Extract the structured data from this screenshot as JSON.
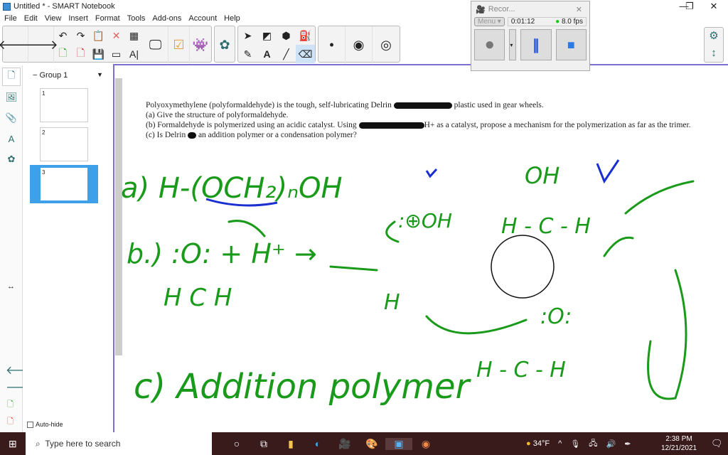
{
  "window": {
    "title": "Untitled * - SMART Notebook"
  },
  "menu": [
    "File",
    "Edit",
    "View",
    "Insert",
    "Format",
    "Tools",
    "Add-ons",
    "Account",
    "Help"
  ],
  "sorter": {
    "group_label": "Group 1",
    "pages": [
      "1",
      "2",
      "3"
    ],
    "auto_hide": "Auto-hide"
  },
  "recorder": {
    "title": "Recor...",
    "menu_label": "Menu",
    "time": "0:01:12",
    "fps": "8.0 fps"
  },
  "question": {
    "line1a": "Polyoxymethylene (polyformaldehyde) is the tough, self-lubricating Delrin",
    "line1b": "plastic used in gear wheels.",
    "line2": "(a) Give the structure of polyformaldehyde.",
    "line3a": "(b) Formaldehyde is polymerized using an acidic catalyst. Using",
    "line3b": "H+ as a catalyst, propose a mechanism for the polymerization as far as the trimer.",
    "line4a": "(c) Is Delrin",
    "line4b": "an addition polymer or a condensation polymer?"
  },
  "handwriting": {
    "a": "a) H-(OCH₂)ₙOH",
    "b": "b.)  :O:  + H⁺ →",
    "b2": "H   C   H",
    "c": "c) Addition polymer",
    "oh": "OH",
    "hch": "H - C - H",
    "plus": ":⊕OH",
    "h": "H",
    "o2": ":O:",
    "hch2": "H - C - H"
  },
  "taskbar": {
    "search_placeholder": "Type here to search",
    "weather": "34°F",
    "time": "2:38 PM",
    "date": "12/21/2021"
  },
  "colors": {
    "ink_green": "#1a9a1a",
    "ink_blue": "#1a2fd0",
    "accent": "#7b6fd0"
  }
}
